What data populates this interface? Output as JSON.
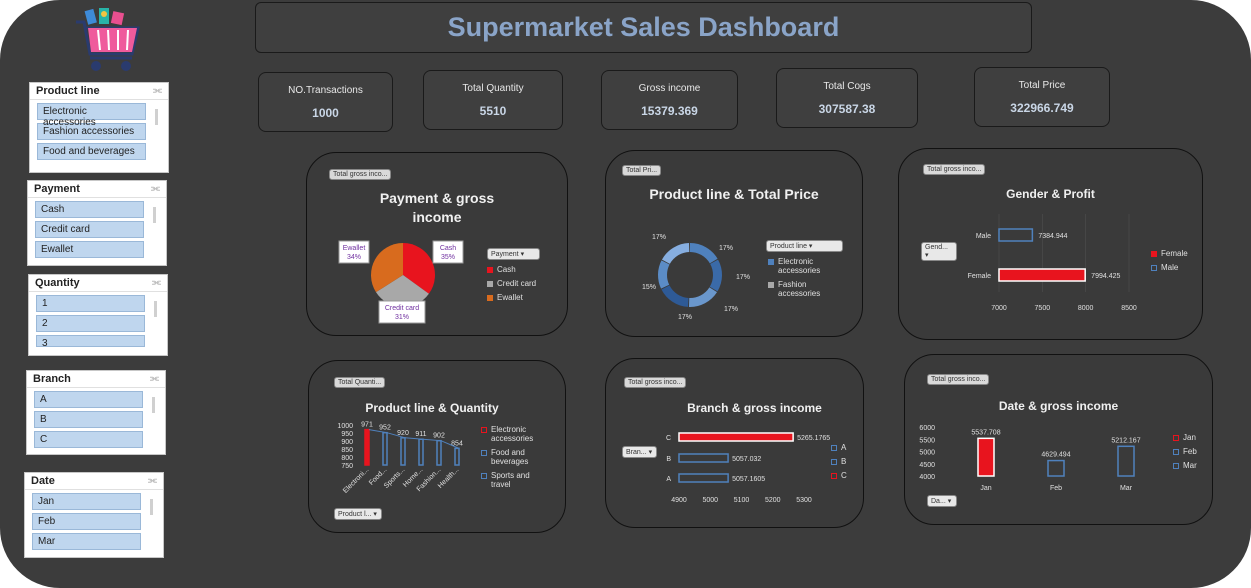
{
  "title": "Supermarket Sales Dashboard",
  "kpis": [
    {
      "label": "NO.Transactions",
      "value": "1000"
    },
    {
      "label": "Total Quantity",
      "value": "5510"
    },
    {
      "label": "Gross income",
      "value": "15379.369"
    },
    {
      "label": "Total Cogs",
      "value": "307587.38"
    },
    {
      "label": "Total Price",
      "value": "322966.749"
    }
  ],
  "slicers": {
    "product_line": {
      "header": "Product line",
      "items": [
        "Electronic accessories",
        "Fashion accessories",
        "Food and beverages"
      ]
    },
    "payment": {
      "header": "Payment",
      "items": [
        "Cash",
        "Credit card",
        "Ewallet"
      ]
    },
    "quantity": {
      "header": "Quantity",
      "items": [
        "1",
        "2",
        "3"
      ]
    },
    "branch": {
      "header": "Branch",
      "items": [
        "A",
        "B",
        "C"
      ]
    },
    "date": {
      "header": "Date",
      "items": [
        "Jan",
        "Feb",
        "Mar"
      ]
    }
  },
  "charts": {
    "payment": {
      "title": "Payment & gross income",
      "field_button": "Total gross inco...",
      "filter_dropdown": "Payment",
      "chart_data": {
        "type": "pie",
        "categories": [
          "Cash",
          "Credit card",
          "Ewallet"
        ],
        "values": [
          35,
          31,
          34
        ],
        "data_labels": [
          {
            "name": "Cash",
            "pct": "35%"
          },
          {
            "name": "Credit card",
            "pct": "31%"
          },
          {
            "name": "Ewallet",
            "pct": "34%"
          }
        ],
        "colors": [
          "#e8141e",
          "#a8a8a8",
          "#d86b1e"
        ],
        "legend": [
          "Cash",
          "Credit card",
          "Ewallet"
        ]
      }
    },
    "product_price": {
      "title": "Product line & Total Price",
      "field_button": "Total Pri...",
      "filter_dropdown": "Product line",
      "chart_data": {
        "type": "pie",
        "subtype": "doughnut",
        "values": [
          17,
          17,
          17,
          17,
          15,
          17
        ],
        "labels": [
          "17%",
          "17%",
          "17%",
          "17%",
          "15%",
          "17%"
        ],
        "legend": [
          "Electronic accessories",
          "Fashion accessories"
        ],
        "colors": [
          "#4f81bd",
          "#3a6aa8",
          "#6a97cc",
          "#2e5a96",
          "#5b8cc6",
          "#86aee0"
        ]
      }
    },
    "gender": {
      "title": "Gender & Profit",
      "field_button": "Total gross inco...",
      "filter_dropdown": "Gend...",
      "chart_data": {
        "type": "bar",
        "orientation": "horizontal",
        "categories": [
          "Male",
          "Female"
        ],
        "values": [
          7384.944,
          7994.425
        ],
        "data_labels": [
          "7384.944",
          "7994.425"
        ],
        "xlim": [
          7000,
          8500
        ],
        "xticks": [
          "7000",
          "7500",
          "8000",
          "8500"
        ],
        "legend": [
          "Female",
          "Male"
        ],
        "colors": {
          "Female": "#e8141e",
          "Male": "#4f81bd"
        }
      }
    },
    "product_qty": {
      "title": "Product line & Quantity",
      "field_button": "Total Quanti...",
      "filter_dropdown": "Product l...",
      "chart_data": {
        "type": "bar",
        "categories": [
          "Electroni...",
          "Food...",
          "Sports...",
          "Home...",
          "Fashion...",
          "Health..."
        ],
        "values": [
          971,
          952,
          920,
          911,
          902,
          854
        ],
        "data_labels": [
          "971",
          "952",
          "920",
          "911",
          "902",
          "854"
        ],
        "ylim": [
          750,
          1000
        ],
        "yticks": [
          "1000",
          "950",
          "900",
          "850",
          "800",
          "750"
        ],
        "legend": [
          "Electronic accessories",
          "Food and beverages",
          "Sports and travel"
        ],
        "colors": [
          "#e8141e",
          "#4f81bd",
          "#4f81bd",
          "#4f81bd",
          "#4f81bd",
          "#4f81bd"
        ]
      }
    },
    "branch": {
      "title": "Branch & gross income",
      "field_button": "Total gross inco...",
      "filter_dropdown": "Bran...",
      "chart_data": {
        "type": "bar",
        "orientation": "horizontal",
        "categories": [
          "C",
          "B",
          "A"
        ],
        "values": [
          5265.1765,
          5057.032,
          5057.1605
        ],
        "data_labels": [
          "5265.1765",
          "5057.032",
          "5057.1605"
        ],
        "xlim": [
          4900,
          5300
        ],
        "xticks": [
          "4900",
          "5000",
          "5100",
          "5200",
          "5300"
        ],
        "legend": [
          "A",
          "B",
          "C"
        ],
        "colors": {
          "C": "#e8141e",
          "B": "#4f81bd",
          "A": "#4f81bd"
        }
      }
    },
    "date": {
      "title": "Date & gross income",
      "field_button": "Total gross inco...",
      "filter_dropdown": "Da...",
      "chart_data": {
        "type": "bar",
        "categories": [
          "Jan",
          "Feb",
          "Mar"
        ],
        "values": [
          5537.708,
          4629.494,
          5212.167
        ],
        "data_labels": [
          "5537.708",
          "4629.494",
          "5212.167"
        ],
        "ylim": [
          4000,
          6000
        ],
        "yticks": [
          "6000",
          "5500",
          "5000",
          "4500",
          "4000"
        ],
        "legend": [
          "Jan",
          "Feb",
          "Mar"
        ],
        "colors": {
          "Jan": "#e8141e",
          "Feb": "#4f81bd",
          "Mar": "#4f81bd"
        }
      }
    }
  }
}
